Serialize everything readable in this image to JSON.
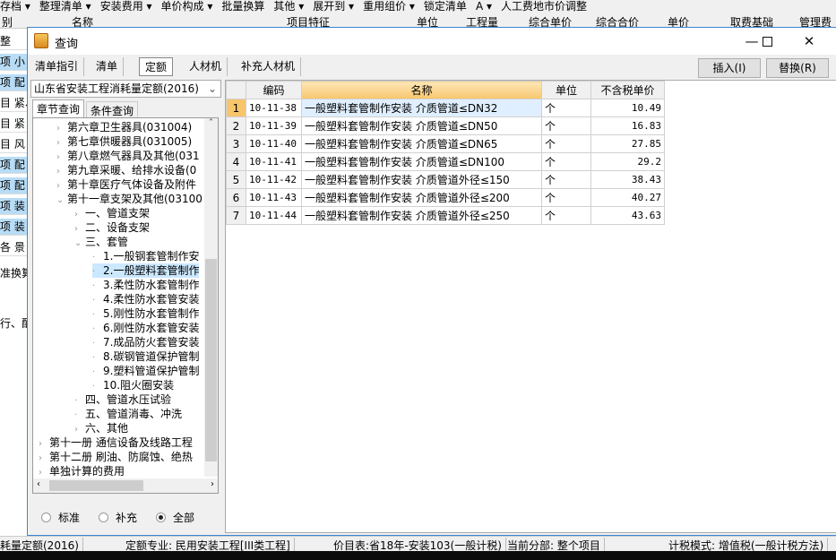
{
  "background": {
    "toolbar": [
      "存档 ▾",
      "整理清单 ▾",
      "安装费用 ▾",
      "单价构成 ▾",
      "批量换算",
      "其他 ▾",
      "展开到 ▾",
      "重用组价 ▾",
      "锁定清单",
      "A ▾",
      "人工费地市价调整"
    ],
    "columns": [
      "别",
      "名称",
      "项目特征",
      "单位",
      "工程量",
      "综合单价",
      "综合合价",
      "单价",
      "取费基础",
      "管理费"
    ],
    "rows": [
      "整",
      "项 小",
      "项 配",
      "目 紧、m",
      "目 紧",
      "目 风",
      "项 配",
      "项 配",
      "项 装",
      "项 装",
      "各 景"
    ],
    "side_text": [
      "准换算",
      "行、配"
    ]
  },
  "dialog": {
    "title": "查询",
    "tabs": [
      "清单指引",
      "清单",
      "定额",
      "人材机",
      "补充人材机"
    ],
    "active_tab": "定额",
    "insert_button": "插入(I)",
    "replace_button": "替换(R)",
    "library": "山东省安装工程消耗量定额(2016)",
    "left_tabs": [
      "章节查询",
      "条件查询"
    ],
    "tree": [
      {
        "label": "第六章卫生器具(031004)",
        "level": 1,
        "state": "collapsed"
      },
      {
        "label": "第七章供暖器具(031005)",
        "level": 1,
        "state": "collapsed"
      },
      {
        "label": "第八章燃气器具及其他(031",
        "level": 1,
        "state": "collapsed"
      },
      {
        "label": "第九章采暖、给排水设备(0",
        "level": 1,
        "state": "collapsed"
      },
      {
        "label": "第十章医疗气体设备及附件",
        "level": 1,
        "state": "collapsed"
      },
      {
        "label": "第十一章支架及其他(03100",
        "level": 1,
        "state": "expanded"
      },
      {
        "label": "一、管道支架",
        "level": 2,
        "state": "collapsed"
      },
      {
        "label": "二、设备支架",
        "level": 2,
        "state": "collapsed"
      },
      {
        "label": "三、套管",
        "level": 2,
        "state": "expanded"
      },
      {
        "label": "1.一般钢套管制作安",
        "level": 3,
        "state": "leaf"
      },
      {
        "label": "2.一般塑料套管制作",
        "level": 3,
        "state": "leaf",
        "selected": true
      },
      {
        "label": "3.柔性防水套管制作",
        "level": 3,
        "state": "leaf"
      },
      {
        "label": "4.柔性防水套管安装",
        "level": 3,
        "state": "leaf"
      },
      {
        "label": "5.刚性防水套管制作",
        "level": 3,
        "state": "leaf"
      },
      {
        "label": "6.刚性防水套管安装",
        "level": 3,
        "state": "leaf"
      },
      {
        "label": "7.成品防火套管安装",
        "level": 3,
        "state": "leaf"
      },
      {
        "label": "8.碳钢管道保护管制",
        "level": 3,
        "state": "leaf"
      },
      {
        "label": "9.塑料管道保护管制",
        "level": 3,
        "state": "leaf"
      },
      {
        "label": "10.阻火圈安装",
        "level": 3,
        "state": "leaf"
      },
      {
        "label": "四、管道水压试验",
        "level": 2,
        "state": "leaf"
      },
      {
        "label": "五、管道消毒、冲洗",
        "level": 2,
        "state": "leaf"
      },
      {
        "label": "六、其他",
        "level": 2,
        "state": "collapsed"
      },
      {
        "label": "第十一册 通信设备及线路工程",
        "level": 0,
        "state": "collapsed"
      },
      {
        "label": "第十二册 刷油、防腐蚀、绝热",
        "level": 0,
        "state": "collapsed"
      },
      {
        "label": "单独计算的费用",
        "level": 0,
        "state": "collapsed"
      }
    ],
    "filter": {
      "options": [
        "标准",
        "补充",
        "全部"
      ],
      "selected": "全部"
    },
    "table": {
      "headers": [
        "编码",
        "名称",
        "单位",
        "不含税单价"
      ],
      "rows": [
        [
          "1",
          "10-11-38",
          "一般塑料套管制作安装 介质管道≤DN32",
          "个",
          "10.49"
        ],
        [
          "2",
          "10-11-39",
          "一般塑料套管制作安装 介质管道≤DN50",
          "个",
          "16.83"
        ],
        [
          "3",
          "10-11-40",
          "一般塑料套管制作安装 介质管道≤DN65",
          "个",
          "27.85"
        ],
        [
          "4",
          "10-11-41",
          "一般塑料套管制作安装 介质管道≤DN100",
          "个",
          "29.2"
        ],
        [
          "5",
          "10-11-42",
          "一般塑料套管制作安装 介质管道外径≤150",
          "个",
          "38.43"
        ],
        [
          "6",
          "10-11-43",
          "一般塑料套管制作安装 介质管道外径≤200",
          "个",
          "40.27"
        ],
        [
          "7",
          "10-11-44",
          "一般塑料套管制作安装 介质管道外径≤250",
          "个",
          "43.63"
        ]
      ]
    }
  },
  "status": [
    "耗量定额(2016)",
    "定额专业: 民用安装工程[III类工程]",
    "价目表:省18年-安装103(一般计税)",
    "当前分部: 整个项目",
    "计税模式: 增值税(一般计税方法)"
  ]
}
